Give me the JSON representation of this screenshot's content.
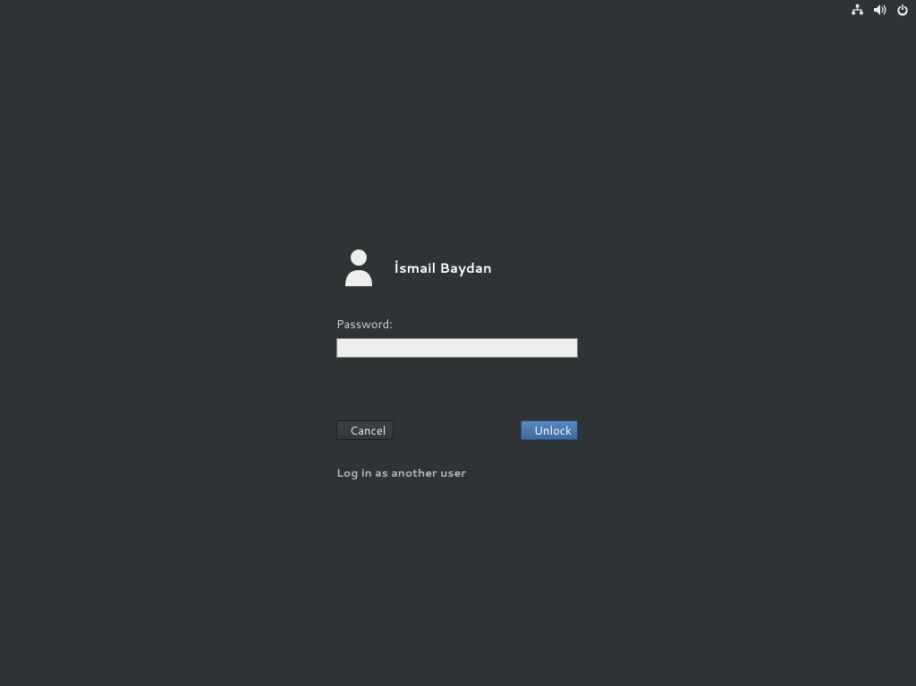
{
  "status": {
    "network_icon": "wired-network",
    "volume_icon": "audio-volume-high",
    "power_icon": "system-shutdown"
  },
  "login": {
    "user_icon": "avatar-default",
    "username": "İsmail Baydan",
    "password_label": "Password:",
    "password_value": "",
    "cancel_label": "Cancel",
    "unlock_label": "Unlock",
    "other_user_label": "Log in as another user"
  }
}
